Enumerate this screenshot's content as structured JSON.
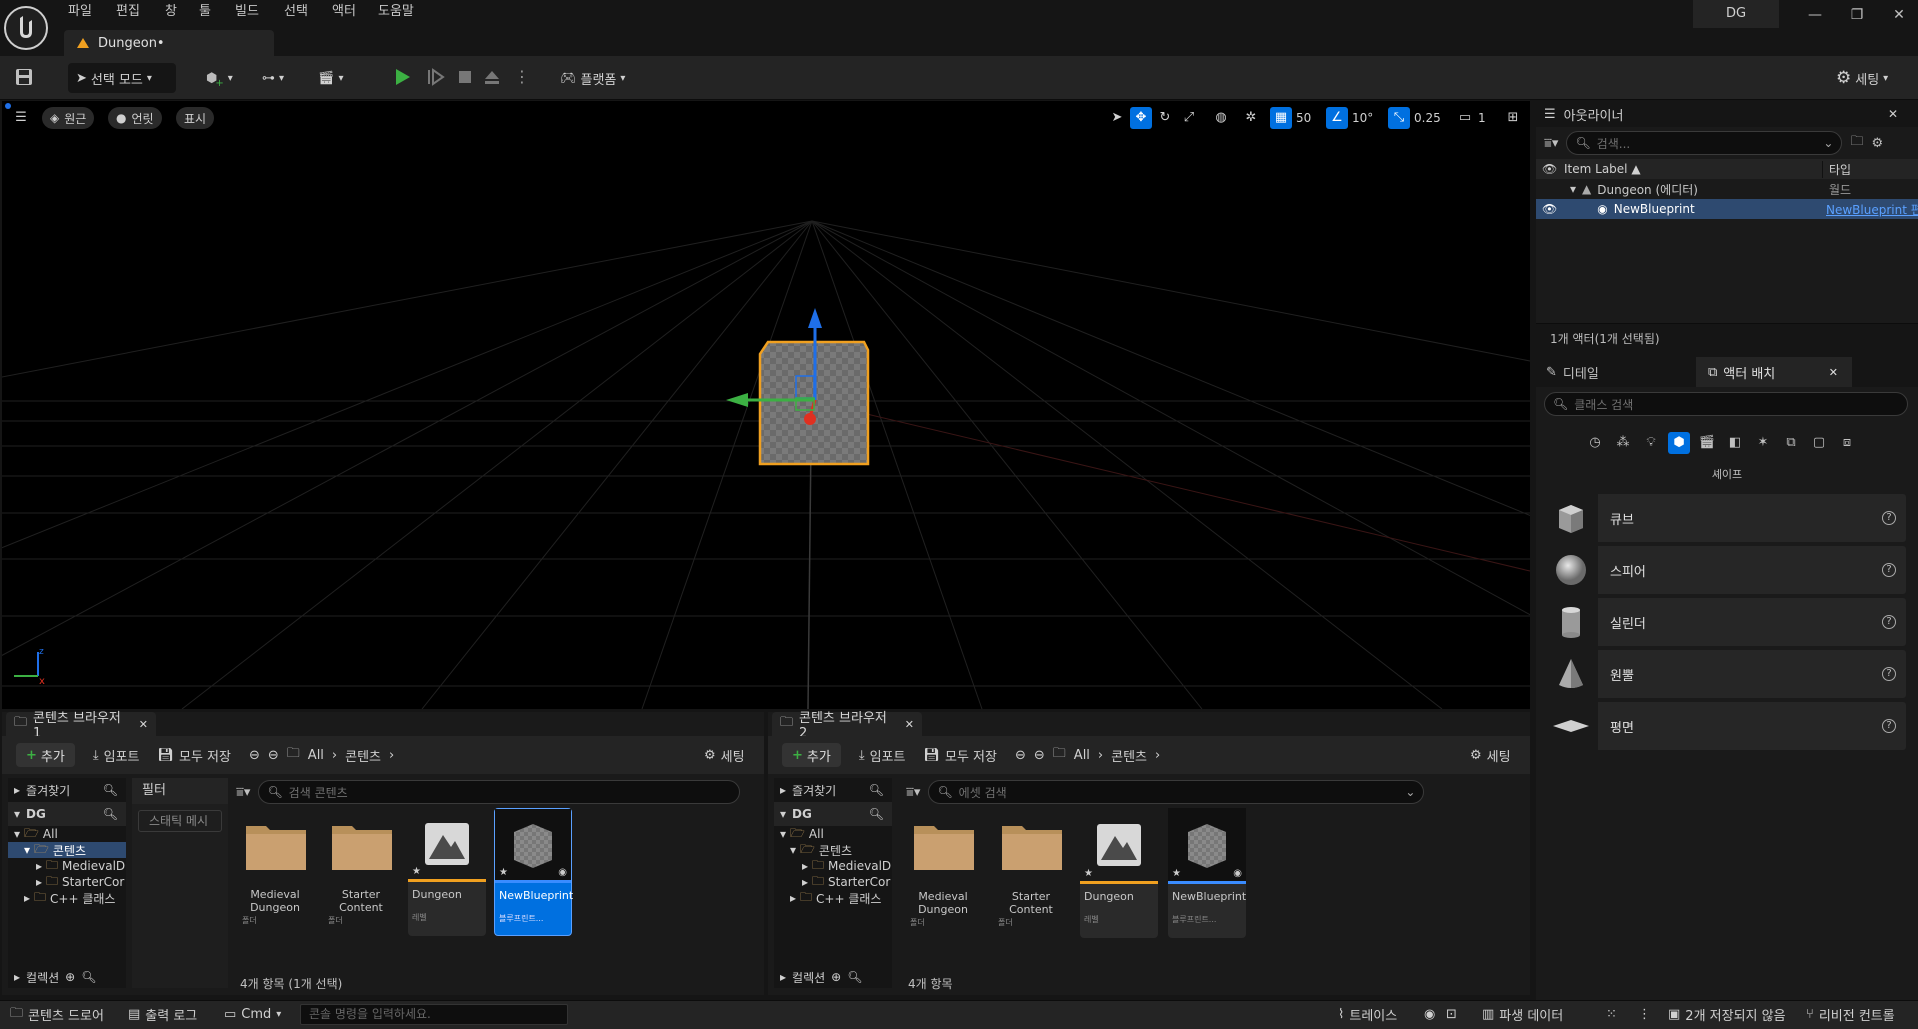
{
  "menu": [
    "파일",
    "편집",
    "창",
    "툴",
    "빌드",
    "선택",
    "액터",
    "도움말"
  ],
  "document_tab": "Dungeon•",
  "project_name": "DG",
  "toolbar": {
    "mode_label": "선택 모드",
    "platform_label": "플랫폼",
    "settings_label": "세팅"
  },
  "viewport": {
    "perspective_label": "원근",
    "lit_label": "언릿",
    "show_label": "표시",
    "grid_snap": "50",
    "rotation_snap": "10°",
    "scale_snap": "0.25",
    "camera_speed": "1"
  },
  "outliner": {
    "title": "아웃라이너",
    "search_placeholder": "검색...",
    "col_label": "Item Label ▲",
    "col_type": "타입",
    "rows": [
      {
        "label": "Dungeon (에디터)",
        "type": "월드"
      },
      {
        "label": "NewBlueprint",
        "type": "NewBlueprint 편"
      }
    ],
    "status": "1개 액터(1개 선택됨)"
  },
  "place_actors": {
    "details_tab": "디테일",
    "place_tab": "액터 배치",
    "search_placeholder": "클래스 검색",
    "category_label": "셰이프",
    "shapes": [
      "큐브",
      "스피어",
      "실린더",
      "원뿔",
      "평면"
    ]
  },
  "cb1": {
    "title": "콘텐츠 브라우저 1",
    "add": "추가",
    "import": "임포트",
    "save_all": "모두 저장",
    "path": [
      "All",
      "콘텐츠"
    ],
    "settings": "세팅",
    "favorites": "즐겨찾기",
    "project": "DG",
    "tree": [
      "All",
      "콘텐츠",
      "MedievalD",
      "StarterCor",
      "C++ 클래스"
    ],
    "collections": "컬렉션",
    "filter_title": "필터",
    "filter_chip": "스태틱 메시",
    "search_placeholder": "검색 콘텐츠",
    "assets": [
      {
        "name": "Medieval Dungeon",
        "type": "폴더"
      },
      {
        "name": "Starter Content",
        "type": "폴더"
      },
      {
        "name": "Dungeon",
        "type": "레벨"
      },
      {
        "name": "NewBlueprint",
        "type": "블루프린트..."
      }
    ],
    "status": "4개 항목 (1개 선택)"
  },
  "cb2": {
    "title": "콘텐츠 브라우저 2",
    "add": "추가",
    "import": "임포트",
    "save_all": "모두 저장",
    "path": [
      "All",
      "콘텐츠"
    ],
    "settings": "세팅",
    "favorites": "즐겨찾기",
    "project": "DG",
    "tree": [
      "All",
      "콘텐츠",
      "MedievalD",
      "StarterCor",
      "C++ 클래스"
    ],
    "collections": "컬렉션",
    "search_placeholder": "에셋 검색",
    "assets": [
      {
        "name": "Medieval Dungeon",
        "type": "폴더"
      },
      {
        "name": "Starter Content",
        "type": "폴더"
      },
      {
        "name": "Dungeon",
        "type": "레벨"
      },
      {
        "name": "NewBlueprint",
        "type": "블루프린트..."
      }
    ],
    "status": "4개 항목"
  },
  "statusbar": {
    "content_drawer": "콘텐츠 드로어",
    "output_log": "출력 로그",
    "cmd": "Cmd",
    "console_placeholder": "콘솔 명령을 입력하세요.",
    "trace": "트레이스",
    "derived_data": "파생 데이터",
    "unsaved": "2개 저장되지 않음",
    "revision": "리비전 컨트롤"
  },
  "colors": {
    "accent_blue": "#0070e0",
    "selection_orange": "#f0a020",
    "play_green": "#3cb043"
  }
}
